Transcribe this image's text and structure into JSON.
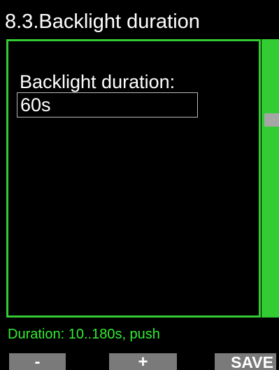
{
  "header": {
    "title": "8.3.Backlight duration"
  },
  "setting": {
    "label": "Backlight duration:",
    "value": "60s"
  },
  "footer": {
    "hint": "Duration: 10..180s, push"
  },
  "softkeys": {
    "minus_label": "-",
    "plus_label": "+",
    "save_label": "SAVE"
  },
  "colors": {
    "accent": "#33cc33",
    "hint": "#33ee33",
    "softkey_bg": "#7a7a7a",
    "scroll_thumb": "#a6a6a6",
    "background": "#000000"
  }
}
